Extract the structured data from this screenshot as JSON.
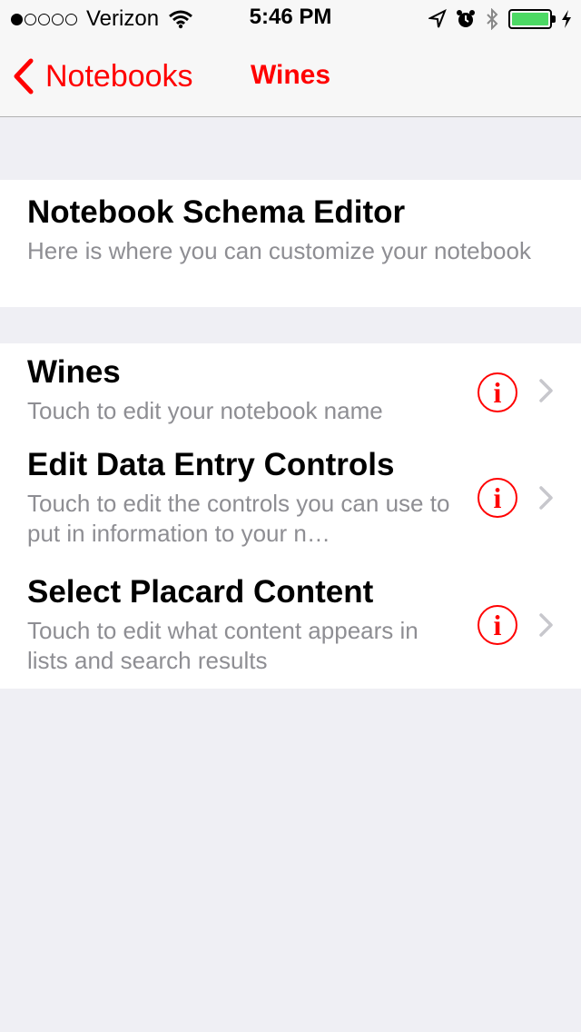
{
  "status_bar": {
    "carrier": "Verizon",
    "time": "5:46 PM",
    "signal_bars_on": 1,
    "signal_bars_total": 5,
    "battery_level": 1.0,
    "battery_color": "#4cd964"
  },
  "nav": {
    "back_label": "Notebooks",
    "title": "Wines",
    "accent_color": "#ff0000"
  },
  "schema_section": {
    "title": "Notebook Schema Editor",
    "subtitle": "Here is where you can customize your notebook"
  },
  "rows": [
    {
      "title": "Wines",
      "subtitle": "Touch to edit your notebook name"
    },
    {
      "title": "Edit Data Entry Controls",
      "subtitle": "Touch to edit the controls you can use to put in information to your n…"
    },
    {
      "title": "Select Placard Content",
      "subtitle": "Touch to edit what content appears in lists and search results"
    }
  ],
  "icons": {
    "info": "info-circle-icon",
    "disclosure": "chevron-right-icon",
    "back": "chevron-left-icon"
  },
  "info_glyph": "i"
}
